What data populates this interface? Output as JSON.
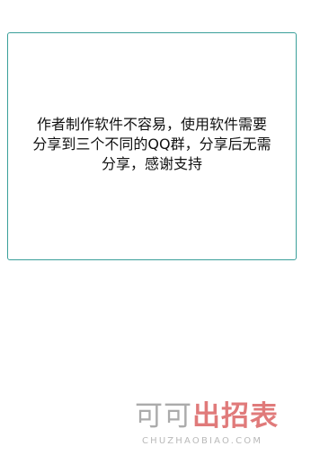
{
  "dialog": {
    "message_lines": [
      "作者制作软件不容易，使用软件需要",
      "分享到三个不同的QQ群，分享后无需",
      "分享，感谢支持"
    ]
  },
  "watermark": {
    "brand_gray": "可可",
    "brand_red": "出招表",
    "url": "CHUZHAOBIAO.COM"
  },
  "colors": {
    "dialog_border": "#3a9f9a",
    "watermark_gray": "#ababab",
    "watermark_red": "#e07a7a"
  }
}
